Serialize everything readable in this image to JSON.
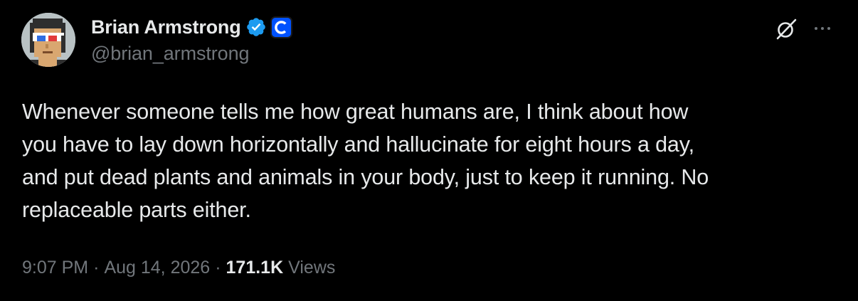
{
  "author": {
    "display_name": "Brian Armstrong",
    "handle": "@brian_armstrong",
    "verified_icon": "verified-badge-icon",
    "affiliate_icon": "coinbase-logo-icon",
    "avatar_icon": "pixel-avatar-icon"
  },
  "actions": {
    "grok_icon": "grok-icon",
    "more_icon": "more-dots-icon"
  },
  "tweet": {
    "text": "Whenever someone tells me how great humans are, I think about how\nyou have to lay down horizontally and hallucinate for eight hours a day,\nand put dead plants and animals in your body, just to keep it running. No\nreplaceable parts either."
  },
  "meta": {
    "time": "9:07 PM",
    "separator": "·",
    "date": "Aug 14, 2026",
    "views_count": "171.1K",
    "views_label": "Views"
  },
  "colors": {
    "background": "#000000",
    "primary_text": "#e7e9ea",
    "secondary_text": "#71767b",
    "verified_blue": "#1d9bf0",
    "coinbase_blue": "#0052ff"
  }
}
